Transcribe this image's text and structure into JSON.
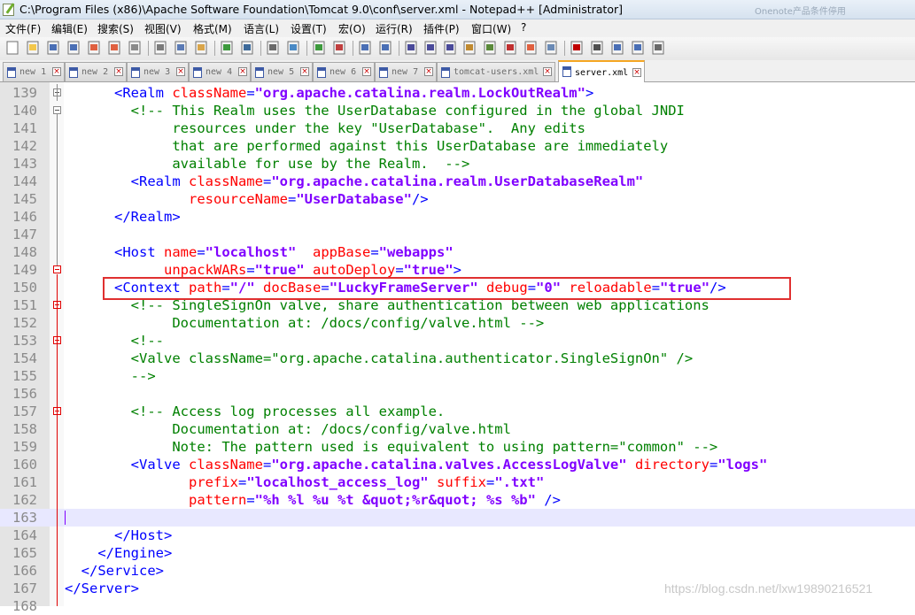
{
  "window": {
    "title": "C:\\Program Files (x86)\\Apache Software Foundation\\Tomcat 9.0\\conf\\server.xml - Notepad++ [Administrator]",
    "ghost_text": "Onenote产品条件停用"
  },
  "menu": [
    {
      "label": "文件(F)"
    },
    {
      "label": "编辑(E)"
    },
    {
      "label": "搜索(S)"
    },
    {
      "label": "视图(V)"
    },
    {
      "label": "格式(M)"
    },
    {
      "label": "语言(L)"
    },
    {
      "label": "设置(T)"
    },
    {
      "label": "宏(O)"
    },
    {
      "label": "运行(R)"
    },
    {
      "label": "插件(P)"
    },
    {
      "label": "窗口(W)"
    },
    {
      "label": "?"
    }
  ],
  "toolbar": [
    {
      "icon": "new-file-icon"
    },
    {
      "icon": "open-file-icon"
    },
    {
      "icon": "save-icon"
    },
    {
      "icon": "save-all-icon"
    },
    {
      "icon": "close-icon"
    },
    {
      "icon": "close-all-icon"
    },
    {
      "icon": "print-icon"
    },
    {
      "icon": "cut-icon"
    },
    {
      "icon": "copy-icon"
    },
    {
      "icon": "paste-icon"
    },
    {
      "icon": "undo-icon"
    },
    {
      "icon": "redo-icon"
    },
    {
      "icon": "find-icon"
    },
    {
      "icon": "replace-icon"
    },
    {
      "icon": "zoom-in-icon"
    },
    {
      "icon": "zoom-out-icon"
    },
    {
      "icon": "sync-vertical-icon"
    },
    {
      "icon": "sync-horizontal-icon"
    },
    {
      "icon": "word-wrap-icon"
    },
    {
      "icon": "show-all-chars-icon"
    },
    {
      "icon": "indent-guide-icon"
    },
    {
      "icon": "udl-icon"
    },
    {
      "icon": "doc-map-icon"
    },
    {
      "icon": "function-list-icon"
    },
    {
      "icon": "folder-workspace-icon"
    },
    {
      "icon": "monitor-icon"
    },
    {
      "icon": "record-macro-icon"
    },
    {
      "icon": "stop-macro-icon"
    },
    {
      "icon": "play-macro-icon"
    },
    {
      "icon": "run-macro-multiple-icon"
    },
    {
      "icon": "save-macro-icon"
    }
  ],
  "tabs": [
    {
      "label": "new 1",
      "active": false
    },
    {
      "label": "new 2",
      "active": false
    },
    {
      "label": "new 3",
      "active": false
    },
    {
      "label": "new 4",
      "active": false
    },
    {
      "label": "new 5",
      "active": false
    },
    {
      "label": "new 6",
      "active": false
    },
    {
      "label": "new 7",
      "active": false
    },
    {
      "label": "tomcat-users.xml",
      "active": false
    },
    {
      "label": "server.xml",
      "active": true
    }
  ],
  "editor": {
    "current_line": 163,
    "lines": [
      {
        "num": "139",
        "indent": "      ",
        "tokens": [
          [
            "tag",
            "<Realm "
          ],
          [
            "attr",
            "className"
          ],
          [
            "tag",
            "="
          ],
          [
            "val",
            "\"org.apache.catalina.realm.LockOutRealm\""
          ],
          [
            "tag",
            ">"
          ]
        ]
      },
      {
        "num": "140",
        "indent": "        ",
        "tokens": [
          [
            "cmt",
            "<!-- This Realm uses the UserDatabase configured in the global JNDI"
          ]
        ]
      },
      {
        "num": "141",
        "indent": "             ",
        "tokens": [
          [
            "cmt",
            "resources under the key \"UserDatabase\".  Any edits"
          ]
        ]
      },
      {
        "num": "142",
        "indent": "             ",
        "tokens": [
          [
            "cmt",
            "that are performed against this UserDatabase are immediately"
          ]
        ]
      },
      {
        "num": "143",
        "indent": "             ",
        "tokens": [
          [
            "cmt",
            "available for use by the Realm.  -->"
          ]
        ]
      },
      {
        "num": "144",
        "indent": "        ",
        "tokens": [
          [
            "tag",
            "<Realm "
          ],
          [
            "attr",
            "className"
          ],
          [
            "tag",
            "="
          ],
          [
            "val",
            "\"org.apache.catalina.realm.UserDatabaseRealm\""
          ]
        ]
      },
      {
        "num": "145",
        "indent": "               ",
        "tokens": [
          [
            "attr",
            "resourceName"
          ],
          [
            "tag",
            "="
          ],
          [
            "val",
            "\"UserDatabase\""
          ],
          [
            "tag",
            "/>"
          ]
        ]
      },
      {
        "num": "146",
        "indent": "      ",
        "tokens": [
          [
            "tag",
            "</Realm>"
          ]
        ]
      },
      {
        "num": "147",
        "indent": "",
        "tokens": []
      },
      {
        "num": "148",
        "indent": "      ",
        "tokens": [
          [
            "tag",
            "<Host "
          ],
          [
            "attr",
            "name"
          ],
          [
            "tag",
            "="
          ],
          [
            "val",
            "\"localhost\""
          ],
          [
            "tag",
            "  "
          ],
          [
            "attr",
            "appBase"
          ],
          [
            "tag",
            "="
          ],
          [
            "val",
            "\"webapps\""
          ]
        ]
      },
      {
        "num": "149",
        "indent": "            ",
        "tokens": [
          [
            "attr",
            "unpackWARs"
          ],
          [
            "tag",
            "="
          ],
          [
            "val",
            "\"true\""
          ],
          [
            "tag",
            " "
          ],
          [
            "attr",
            "autoDeploy"
          ],
          [
            "tag",
            "="
          ],
          [
            "val",
            "\"true\""
          ],
          [
            "tag",
            ">"
          ]
        ]
      },
      {
        "num": "150",
        "indent": "      ",
        "tokens": [
          [
            "tag",
            "<Context "
          ],
          [
            "attr",
            "path"
          ],
          [
            "tag",
            "="
          ],
          [
            "val",
            "\"/\""
          ],
          [
            "tag",
            " "
          ],
          [
            "attr",
            "docBase"
          ],
          [
            "tag",
            "="
          ],
          [
            "val",
            "\"LuckyFrameServer\""
          ],
          [
            "tag",
            " "
          ],
          [
            "attr",
            "debug"
          ],
          [
            "tag",
            "="
          ],
          [
            "val",
            "\"0\""
          ],
          [
            "tag",
            " "
          ],
          [
            "attr",
            "reloadable"
          ],
          [
            "tag",
            "="
          ],
          [
            "val",
            "\"true\""
          ],
          [
            "tag",
            "/>"
          ]
        ]
      },
      {
        "num": "151",
        "indent": "        ",
        "tokens": [
          [
            "cmt",
            "<!-- SingleSignOn valve, share authentication between web applications"
          ]
        ]
      },
      {
        "num": "152",
        "indent": "             ",
        "tokens": [
          [
            "cmt",
            "Documentation at: /docs/config/valve.html -->"
          ]
        ]
      },
      {
        "num": "153",
        "indent": "        ",
        "tokens": [
          [
            "cmt",
            "<!--"
          ]
        ]
      },
      {
        "num": "154",
        "indent": "        ",
        "tokens": [
          [
            "cmt",
            "<Valve className=\"org.apache.catalina.authenticator.SingleSignOn\" />"
          ]
        ]
      },
      {
        "num": "155",
        "indent": "        ",
        "tokens": [
          [
            "cmt",
            "-->"
          ]
        ]
      },
      {
        "num": "156",
        "indent": "",
        "tokens": []
      },
      {
        "num": "157",
        "indent": "        ",
        "tokens": [
          [
            "cmt",
            "<!-- Access log processes all example."
          ]
        ]
      },
      {
        "num": "158",
        "indent": "             ",
        "tokens": [
          [
            "cmt",
            "Documentation at: /docs/config/valve.html"
          ]
        ]
      },
      {
        "num": "159",
        "indent": "             ",
        "tokens": [
          [
            "cmt",
            "Note: The pattern used is equivalent to using pattern=\"common\" -->"
          ]
        ]
      },
      {
        "num": "160",
        "indent": "        ",
        "tokens": [
          [
            "tag",
            "<Valve "
          ],
          [
            "attr",
            "className"
          ],
          [
            "tag",
            "="
          ],
          [
            "val",
            "\"org.apache.catalina.valves.AccessLogValve\""
          ],
          [
            "tag",
            " "
          ],
          [
            "attr",
            "directory"
          ],
          [
            "tag",
            "="
          ],
          [
            "val",
            "\"logs\""
          ]
        ]
      },
      {
        "num": "161",
        "indent": "               ",
        "tokens": [
          [
            "attr",
            "prefix"
          ],
          [
            "tag",
            "="
          ],
          [
            "val",
            "\"localhost_access_log\""
          ],
          [
            "tag",
            " "
          ],
          [
            "attr",
            "suffix"
          ],
          [
            "tag",
            "="
          ],
          [
            "val",
            "\".txt\""
          ]
        ]
      },
      {
        "num": "162",
        "indent": "               ",
        "tokens": [
          [
            "attr",
            "pattern"
          ],
          [
            "tag",
            "="
          ],
          [
            "val",
            "\"%h %l %u %t &quot;%r&quot; %s %b\""
          ],
          [
            "tag",
            " />"
          ]
        ]
      },
      {
        "num": "163",
        "indent": "",
        "tokens": []
      },
      {
        "num": "164",
        "indent": "      ",
        "tokens": [
          [
            "tag",
            "</Host>"
          ]
        ]
      },
      {
        "num": "165",
        "indent": "    ",
        "tokens": [
          [
            "tag",
            "</Engine>"
          ]
        ]
      },
      {
        "num": "166",
        "indent": "  ",
        "tokens": [
          [
            "tag",
            "</Service>"
          ]
        ]
      },
      {
        "num": "167",
        "indent": "",
        "tokens": [
          [
            "tag",
            "</Server>"
          ]
        ]
      },
      {
        "num": "168",
        "indent": "",
        "tokens": []
      }
    ]
  },
  "watermark": "https://blog.csdn.net/lxw1989021652 21"
}
